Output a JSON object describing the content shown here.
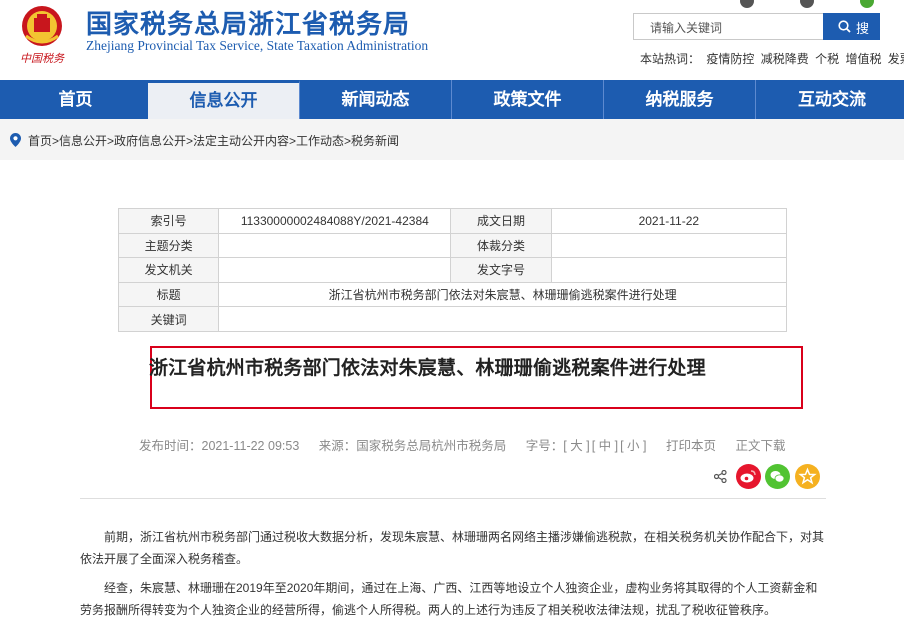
{
  "header": {
    "site_title": "国家税务总局浙江省税务局",
    "site_subtitle": "Zhejiang Provincial Tax Service, State Taxation Administration",
    "emblem_text": "中国税务",
    "search_placeholder": "请输入关键词",
    "search_button": "搜索",
    "hot_label": "本站热词：",
    "hot_words": [
      "疫情防控",
      "减税降费",
      "个税",
      "增值税",
      "发票"
    ]
  },
  "nav": {
    "items": [
      "首页",
      "信息公开",
      "新闻动态",
      "政策文件",
      "纳税服务",
      "互动交流"
    ],
    "active_index": 1
  },
  "breadcrumb": {
    "items": [
      "首页",
      "信息公开",
      "政府信息公开",
      "法定主动公开内容",
      "工作动态",
      "税务新闻"
    ],
    "text": "首页>信息公开>政府信息公开>法定主动公开内容>工作动态>税务新闻"
  },
  "meta_table": {
    "index_label": "索引号",
    "index_value": "11330000002484088Y/2021-42384",
    "date_label": "成文日期",
    "date_value": "2021-11-22",
    "subject_label": "主题分类",
    "genre_label": "体裁分类",
    "issuer_label": "发文机关",
    "docno_label": "发文字号",
    "title_label": "标题",
    "title_value": "浙江省杭州市税务部门依法对朱宸慧、林珊珊偷逃税案件进行处理",
    "keywords_label": "关键词"
  },
  "article": {
    "title": "浙江省杭州市税务部门依法对朱宸慧、林珊珊偷逃税案件进行处理",
    "publish_time": "发布时间：2021-11-22  09:53",
    "source": "来源：国家税务总局杭州市税务局",
    "font_size_label": "字号：",
    "font_large": "[ 大 ]",
    "font_medium": "[ 中 ]",
    "font_small": "[ 小 ]",
    "print_label": "打印本页",
    "download_label": "正文下载",
    "paragraph1": "前期，浙江省杭州市税务部门通过税收大数据分析，发现朱宸慧、林珊珊两名网络主播涉嫌偷逃税款，在相关税务机关协作配合下，对其依法开展了全面深入税务稽查。",
    "paragraph2": "经查，朱宸慧、林珊珊在2019年至2020年期间，通过在上海、广西、江西等地设立个人独资企业，虚构业务将其取得的个人工资薪金和劳务报酬所得转变为个人独资企业的经营所得，偷逃个人所得税。两人的上述行为违反了相关税收法律法规，扰乱了税收征管秩序。"
  },
  "colors": {
    "brand_blue": "#1d5cb0",
    "highlight_red": "#d9001b",
    "weibo_red": "#e6162d",
    "wechat_green": "#51c332",
    "favorite_yellow": "#f5b120"
  }
}
